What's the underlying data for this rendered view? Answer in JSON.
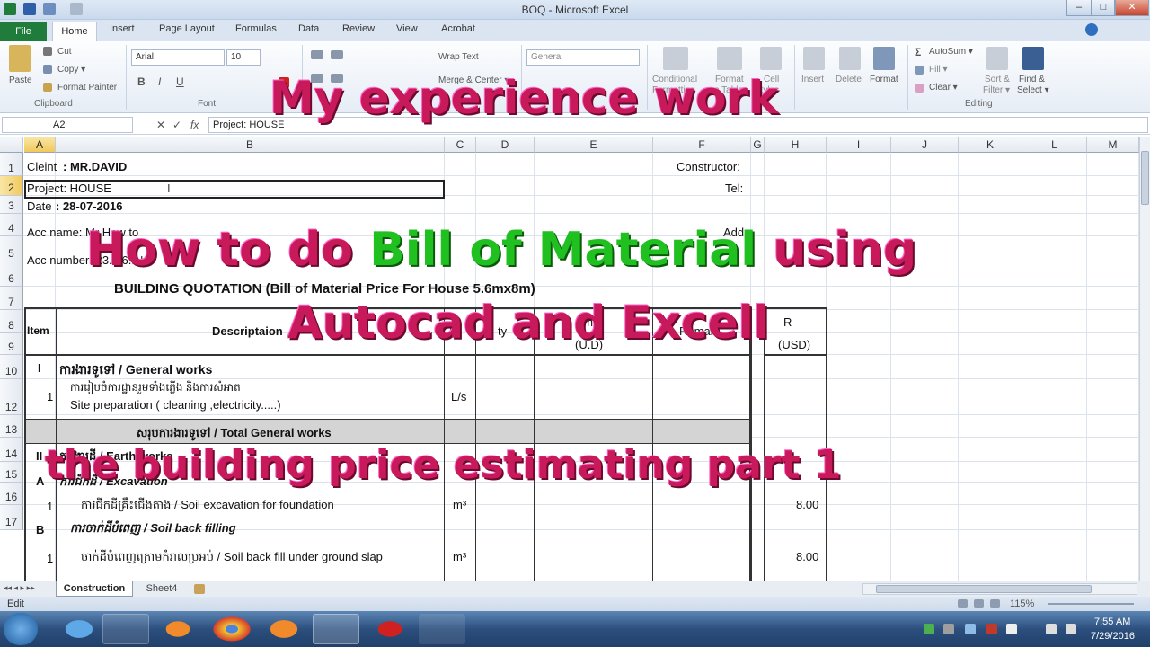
{
  "window": {
    "title": "BOQ - Microsoft Excel",
    "min": "–",
    "max": "□",
    "close": "✕"
  },
  "ribbon_tabs": [
    "File",
    "Home",
    "Insert",
    "Page Layout",
    "Formulas",
    "Data",
    "Review",
    "View",
    "Acrobat"
  ],
  "ribbon": {
    "paste": "Paste",
    "cut": "Cut",
    "copy": "Copy ▾",
    "format_painter": "Format Painter",
    "clipboard": "Clipboard",
    "font_name": "Arial",
    "font_size": "10",
    "font_group": "Font",
    "wrap_text": "Wrap Text",
    "merge_center": "Merge & Center ▾",
    "number_format": "General",
    "conditional": "Conditional",
    "formatting": "Formatting",
    "format_as": "Format",
    "as_table": "as Table",
    "cell": "Cell",
    "styles_lbl": "Styles",
    "insert": "Insert",
    "delete": "Delete",
    "format": "Format",
    "autosum": "AutoSum ▾",
    "fill": "Fill ▾",
    "clear": "Clear ▾",
    "sort_filter": "Sort &",
    "filter": "Filter ▾",
    "find_select": "Find &",
    "select": "Select ▾",
    "editing": "Editing"
  },
  "formula_bar": {
    "name_box": "A2",
    "fx": "fx",
    "content": "Project: HOUSE"
  },
  "columns": [
    "A",
    "B",
    "C",
    "D",
    "E",
    "F",
    "G",
    "H",
    "I",
    "J",
    "K",
    "L",
    "M"
  ],
  "rows": [
    "1",
    "2",
    "3",
    "4",
    "5",
    "6",
    "7",
    "8",
    "9",
    "10",
    "12",
    "13",
    "14",
    "15",
    "16",
    "17"
  ],
  "sheet": {
    "client_label": "Cleint",
    "client_value": ": MR.DAVID",
    "project": "Project: HOUSE",
    "date_label": "Date",
    "date_value": ": 28-07-2016",
    "acc_name": "Acc name: Mr How to",
    "acc_number": "Acc number: 23..56..N",
    "constructor": "Constructor:",
    "tel": "Tel:",
    "add": "Add:",
    "quotation_title": "BUILDING QUOTATION (Bill of Material Price For House 5.6mx8m)",
    "hdr_item": "Item",
    "hdr_desc": "Descriptaion",
    "hdr_unit": "U",
    "hdr_qty": "ty",
    "hdr_amount": "am",
    "hdr_ud": "(U.D)",
    "hdr_remark": "Remark",
    "hdr_r": "R",
    "hdr_usd": "(USD)",
    "r9_item": "I",
    "r9_desc": "ការងារទូទៅ / General works",
    "r10_item": "1",
    "r10_kh": "ការរៀបចំការដ្ឋានរួមទាំងភ្លើង និងការសំអាត",
    "r10_en": "Site preparation ( cleaning ,electricity.....)",
    "r10_unit": "L/s",
    "r12_total": "សរុបការងារទូទៅ / Total General works",
    "r13_item": "II",
    "r13_desc": "ការងារដី / Earth works",
    "r14_item": "A",
    "r14_desc": "ការជីកដី / Excavation",
    "r15_item": "1",
    "r15_desc": "ការជីកដីគ្រឹះជើងតាង / Soil excavation for foundation",
    "r15_unit": "m³",
    "r15_price": "8.00",
    "r16_item": "B",
    "r16_desc": "ការចាក់ដីបំពេញ / Soil back filling",
    "r17_item": "1",
    "r17_desc": "ចាក់ដីបំពេញក្រោមកំរាលប្រអប់ / Soil back fill under ground slap",
    "r17_unit": "m³",
    "r17_price": "8.00"
  },
  "sheet_tabs": [
    "Construction",
    "Sheet4"
  ],
  "status": {
    "mode": "Edit",
    "zoom": "115%"
  },
  "taskbar": {
    "time": "7:55 AM",
    "date": "7/29/2016"
  },
  "overlay": {
    "line1": "My experience work",
    "line2a": "How to do ",
    "line2b": "Bill of Material",
    "line2c": " using",
    "line3": "Autocad and Excell",
    "line4": "the building price estimating part 1"
  },
  "colors": {
    "overlay": "#c8195a",
    "overlay_green": "#20c020",
    "file_tab": "#1f7c3a",
    "selection": "#f1c95c"
  }
}
